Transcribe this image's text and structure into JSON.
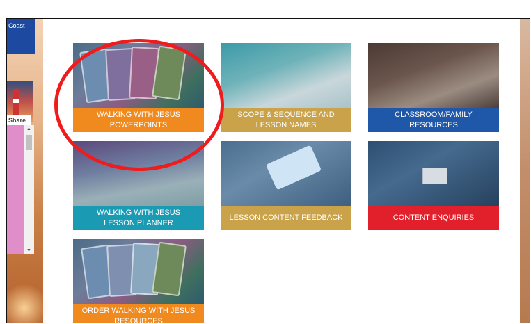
{
  "sidebar": {
    "blue_box_text": "Coast",
    "share_label": "Share",
    "scroll_up_glyph": "▲",
    "scroll_down_glyph": "▼"
  },
  "tiles": [
    {
      "label": "WALKING WITH JESUS\nPOWERPOINTS",
      "color": "#f08a1e"
    },
    {
      "label": "SCOPE & SEQUENCE AND\nLESSON NAMES",
      "color": "#c9a24a"
    },
    {
      "label": "CLASSROOM/FAMILY\nRESOURCES",
      "color": "#1f57a9"
    },
    {
      "label": "WALKING WITH JESUS\nLESSON PLANNER",
      "color": "#1a9ab3"
    },
    {
      "label": "LESSON CONTENT FEEDBACK",
      "color": "#c9a24a"
    },
    {
      "label": "CONTENT ENQUIRIES",
      "color": "#e2202b"
    },
    {
      "label": "ORDER WALKING WITH JESUS\nRESOURCES",
      "color": "#f08a1e"
    }
  ],
  "annotation": {
    "color": "#ee1c1c",
    "target": "WALKING WITH JESUS POWERPOINTS"
  }
}
